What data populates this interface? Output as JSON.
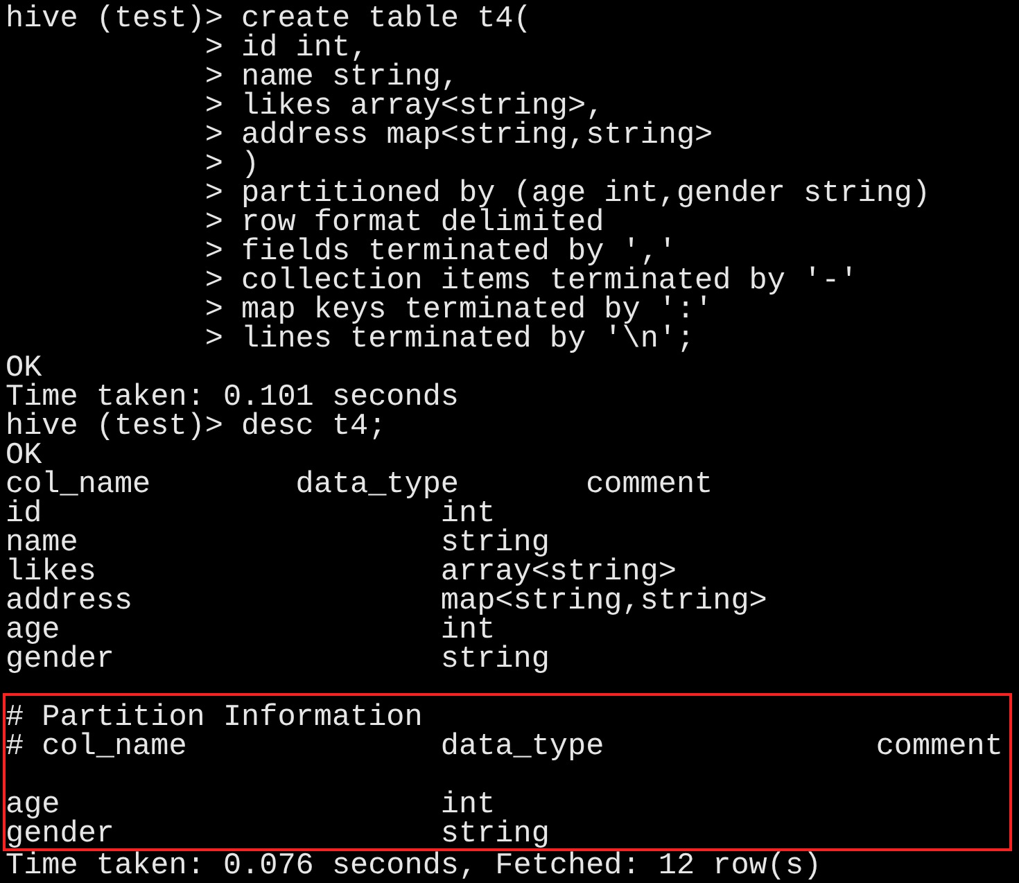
{
  "session": [
    {
      "kind": "prompt",
      "prompt": "hive (test)>",
      "command": "create table t4("
    },
    {
      "kind": "continuation",
      "prompt": ">",
      "command": "id int,"
    },
    {
      "kind": "continuation",
      "prompt": ">",
      "command": "name string,"
    },
    {
      "kind": "continuation",
      "prompt": ">",
      "command": "likes array<string>,"
    },
    {
      "kind": "continuation",
      "prompt": ">",
      "command": "address map<string,string>"
    },
    {
      "kind": "continuation",
      "prompt": ">",
      "command": ")"
    },
    {
      "kind": "continuation",
      "prompt": ">",
      "command": "partitioned by (age int,gender string)"
    },
    {
      "kind": "continuation",
      "prompt": ">",
      "command": "row format delimited"
    },
    {
      "kind": "continuation",
      "prompt": ">",
      "command": "fields terminated by ','"
    },
    {
      "kind": "continuation",
      "prompt": ">",
      "command": "collection items terminated by '-'"
    },
    {
      "kind": "continuation",
      "prompt": ">",
      "command": "map keys terminated by ':'"
    },
    {
      "kind": "continuation",
      "prompt": ">",
      "command": "lines terminated by '\\n';"
    },
    {
      "kind": "output",
      "text": "OK"
    },
    {
      "kind": "output",
      "text": "Time taken: 0.101 seconds"
    },
    {
      "kind": "prompt",
      "prompt": "hive (test)>",
      "command": "desc t4;"
    },
    {
      "kind": "output",
      "text": "OK"
    }
  ],
  "desc_table": {
    "columns": [
      "col_name",
      "data_type",
      "comment"
    ],
    "rows": [
      [
        "id",
        "int"
      ],
      [
        "name",
        "string"
      ],
      [
        "likes",
        "array<string>"
      ],
      [
        "address",
        "map<string,string>"
      ],
      [
        "age",
        "int"
      ],
      [
        "gender",
        "string"
      ]
    ]
  },
  "partition_info": {
    "title": "# Partition Information",
    "columns": [
      "# col_name",
      "data_type",
      "comment"
    ],
    "rows": [
      [
        "age",
        "int"
      ],
      [
        "gender",
        "string"
      ]
    ]
  },
  "footer": "Time taken: 0.076 seconds, Fetched: 12 row(s)"
}
